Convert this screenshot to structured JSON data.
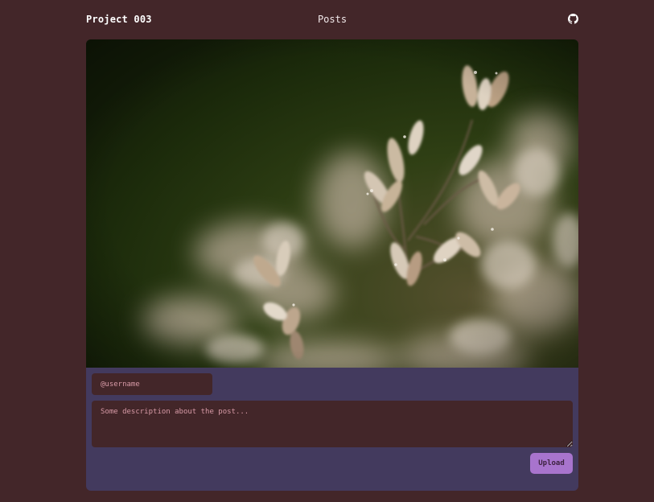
{
  "nav": {
    "brand": "Project 003",
    "posts_link": "Posts",
    "github_icon": "github-icon"
  },
  "post": {
    "image_alt": "Close-up of pale grass flower heads against a dark green background"
  },
  "form": {
    "username_placeholder": "@username",
    "description_placeholder": "Some description about the post...",
    "upload_label": "Upload"
  },
  "colors": {
    "page_background": "#432629",
    "form_panel": "#433a5e",
    "input_background": "#432629",
    "placeholder_text": "#d79aa6",
    "upload_button": "#a874cd"
  }
}
